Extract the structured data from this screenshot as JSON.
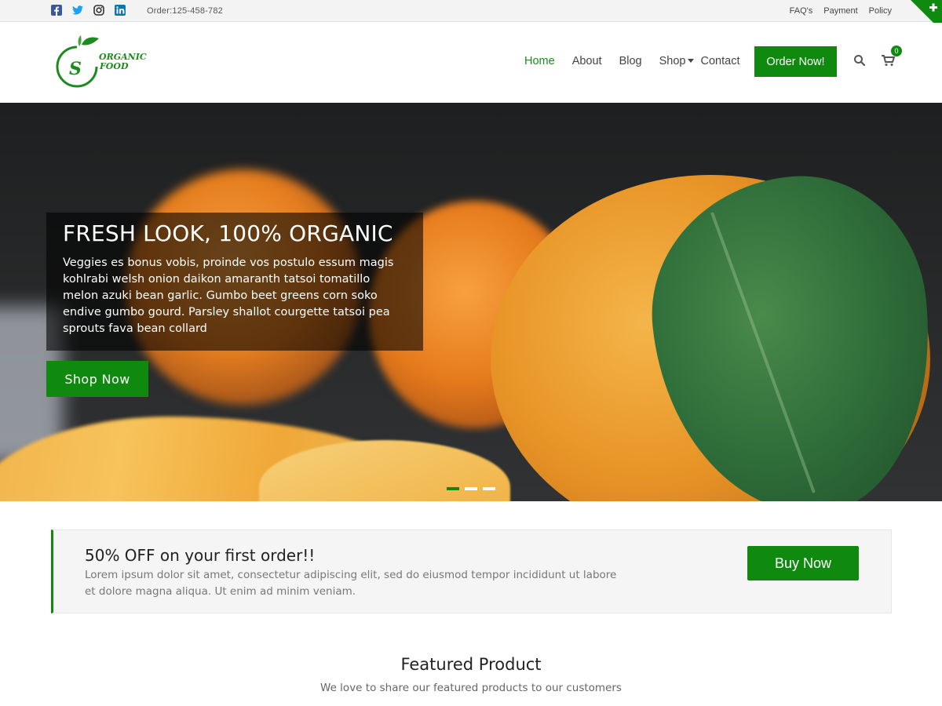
{
  "topbar": {
    "social_icons": [
      "facebook-icon",
      "twitter-icon",
      "instagram-icon",
      "linkedin-icon"
    ],
    "order_phone": "Order:125-458-782",
    "links": [
      "FAQ's",
      "Payment",
      "Policy"
    ]
  },
  "logo": {
    "line1": "ORGANIC",
    "line2": "FOOD",
    "monogram": "S"
  },
  "nav": {
    "items": [
      "Home",
      "About",
      "Blog",
      "Shop",
      "Contact"
    ],
    "active": "Home",
    "order_button": "Order Now!",
    "cart_count": "0"
  },
  "hero": {
    "title": "FRESH LOOK, 100% ORGANIC",
    "text": "Veggies es bonus vobis, proinde vos postulo essum magis kohlrabi welsh onion daikon amaranth tatsoi tomatillo melon azuki bean garlic. Gumbo beet greens corn soko endive gumbo gourd. Parsley shallot courgette tatsoi pea sprouts fava bean collard",
    "button": "Shop Now",
    "slides": 3,
    "active_slide": 1
  },
  "promo": {
    "title": "50% OFF on your first order!!",
    "text": "Lorem ipsum dolor sit amet, consectetur adipiscing elit, sed do eiusmod tempor incididunt ut labore et dolore magna aliqua. Ut enim ad minim veniam.",
    "button": "Buy Now"
  },
  "featured": {
    "title": "Featured Product",
    "subtitle": "We love to share our featured products to our customers"
  },
  "colors": {
    "accent": "#0f8a0f",
    "topbar_bg": "#f3f3f3",
    "promo_bg": "#f5f5f5"
  }
}
